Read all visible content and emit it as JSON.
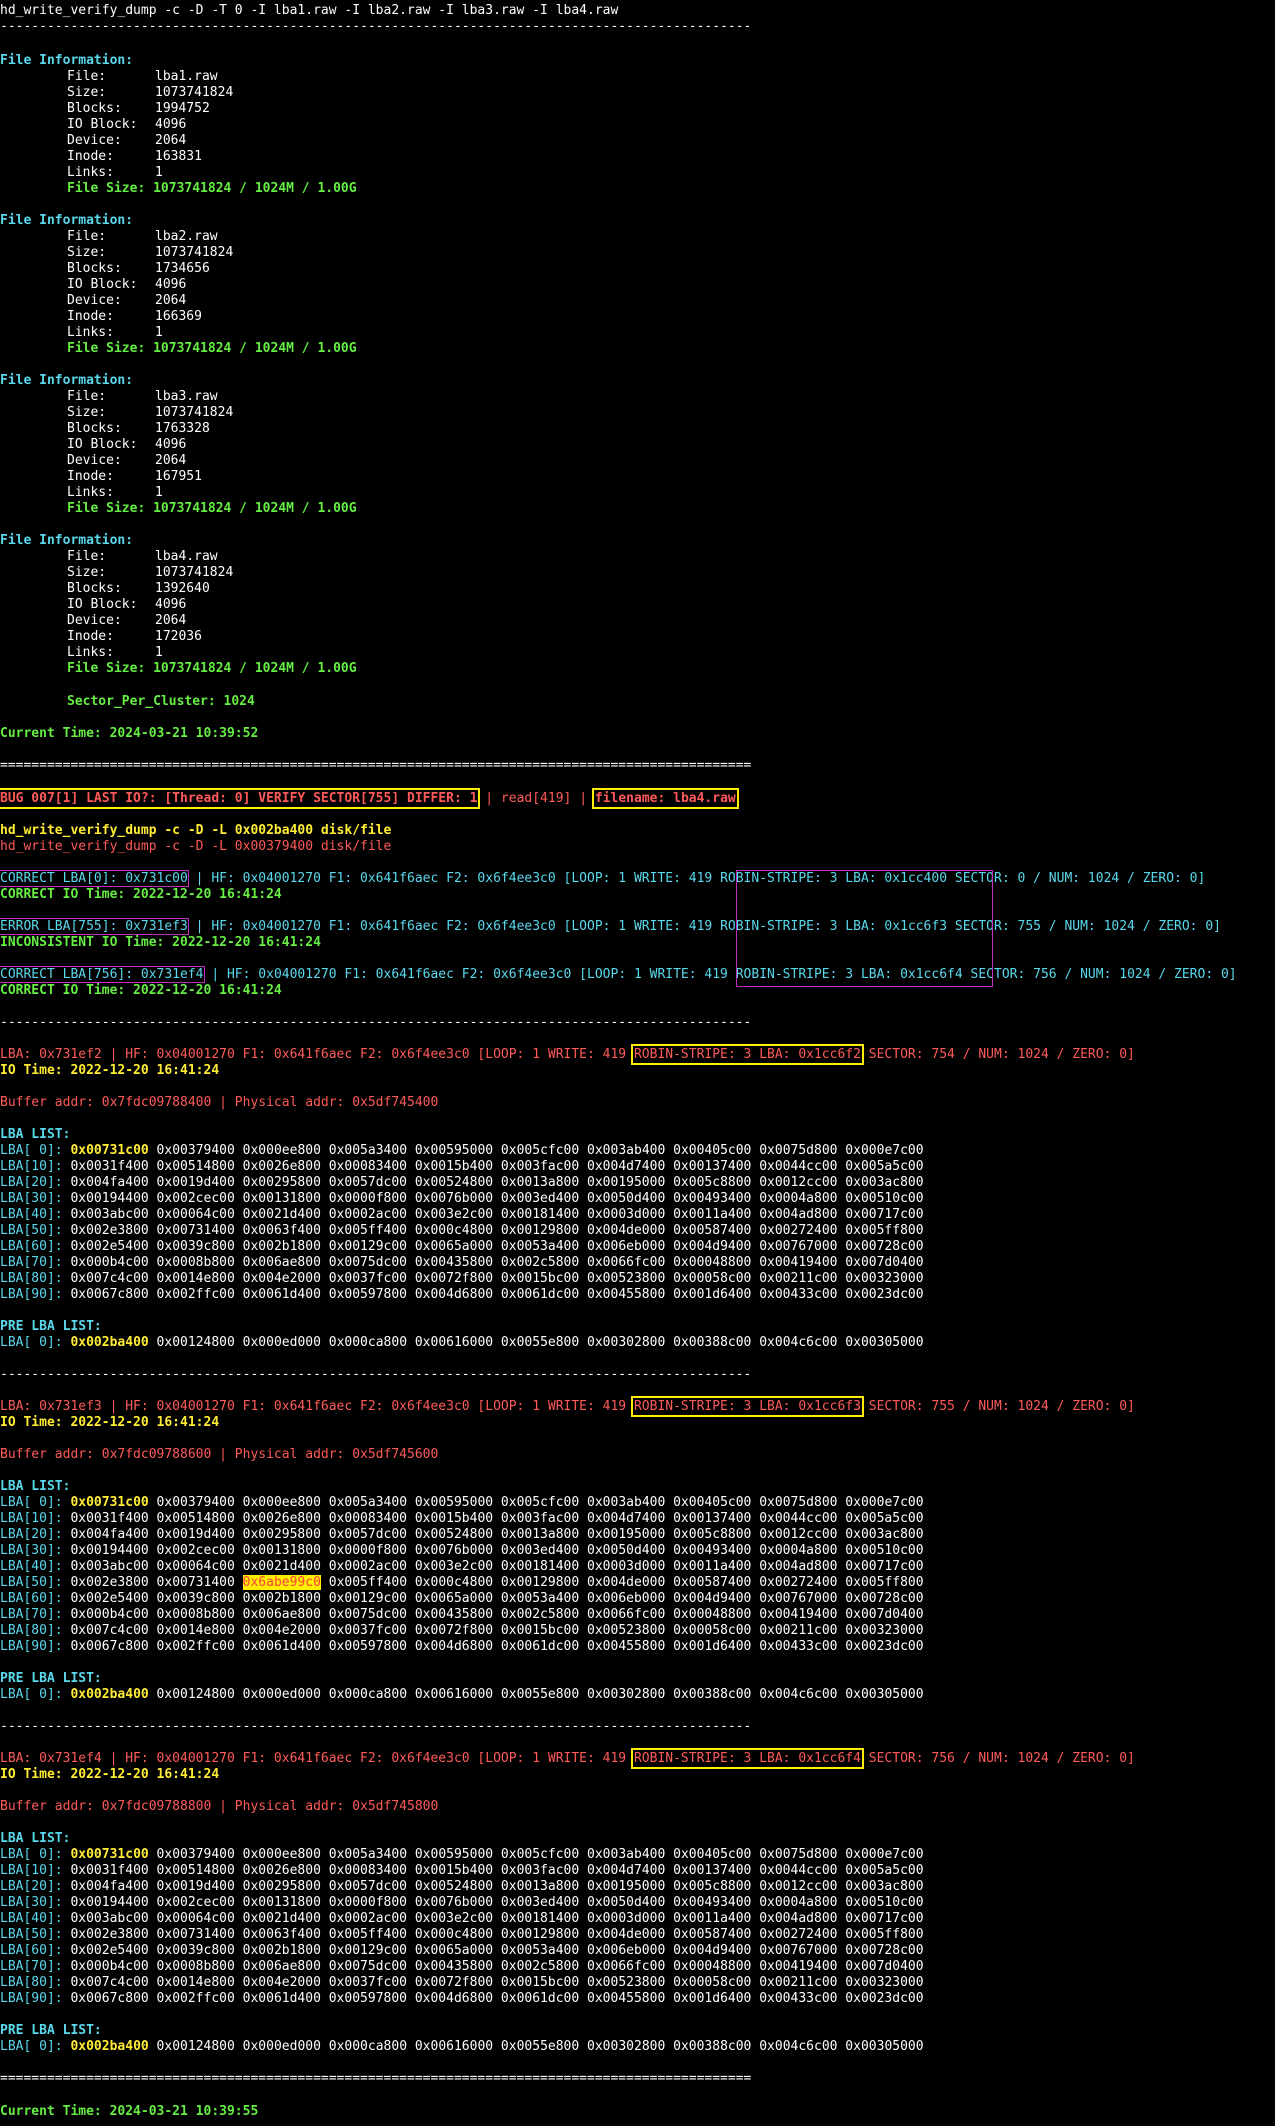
{
  "command": "hd_write_verify_dump -c -D -T 0 -I lba1.raw -I lba2.raw -I lba3.raw -I lba4.raw",
  "separator_dash": "------------------------------------------------------------------------------------------------",
  "separator_eq": "================================================================================================",
  "file_info_header": "File Information:",
  "files": [
    {
      "File:": "lba1.raw",
      "Size:": "1073741824",
      "Blocks:": "1994752",
      "IO Block:": "4096",
      "Device:": "2064",
      "Inode:": "163831",
      "Links:": "1",
      "file_size": "File Size: 1073741824 / 1024M / 1.00G"
    },
    {
      "File:": "lba2.raw",
      "Size:": "1073741824",
      "Blocks:": "1734656",
      "IO Block:": "4096",
      "Device:": "2064",
      "Inode:": "166369",
      "Links:": "1",
      "file_size": "File Size: 1073741824 / 1024M / 1.00G"
    },
    {
      "File:": "lba3.raw",
      "Size:": "1073741824",
      "Blocks:": "1763328",
      "IO Block:": "4096",
      "Device:": "2064",
      "Inode:": "167951",
      "Links:": "1",
      "file_size": "File Size: 1073741824 / 1024M / 1.00G"
    },
    {
      "File:": "lba4.raw",
      "Size:": "1073741824",
      "Blocks:": "1392640",
      "IO Block:": "4096",
      "Device:": "2064",
      "Inode:": "172036",
      "Links:": "1",
      "file_size": "File Size: 1073741824 / 1024M / 1.00G"
    }
  ],
  "field_keys": [
    "File:",
    "Size:",
    "Blocks:",
    "IO Block:",
    "Device:",
    "Inode:",
    "Links:"
  ],
  "sector_per_cluster": "Sector_Per_Cluster: 1024",
  "current_time_1": "Current Time: 2024-03-21 10:39:52",
  "current_time_2": "Current Time: 2024-03-21 10:39:55",
  "bug_line": {
    "bug": "BUG 007[1] LAST IO?: [Thread: 0] VERIFY SECTOR[755] DIFFER: 1",
    "sep1": " | ",
    "read": "read[419]",
    "sep2": " | ",
    "filename": "filename: lba4.raw"
  },
  "dump_cmd_1": "hd_write_verify_dump -c -D -L 0x002ba400 disk/file",
  "dump_cmd_2": "hd_write_verify_dump -c -D -L 0x00379400 disk/file",
  "lba_summary": [
    {
      "tag": "CORRECT LBA[0]: 0x731c00",
      "pre": " | HF: 0x04001270 F1: 0x641f6aec F2: 0x6f4ee3c0 [LOOP: 1 WRITE: 419 ",
      "stripe": "ROBIN-STRIPE: 3 LBA: 0x1cc400",
      "post": " SECTOR: 0 / NUM: 1024 / ZERO: 0]",
      "time": "CORRECT IO Time: 2022-12-20 16:41:24"
    },
    {
      "tag": "ERROR LBA[755]: 0x731ef3",
      "pre": " | HF: 0x04001270 F1: 0x641f6aec F2: 0x6f4ee3c0 [LOOP: 1 WRITE: 419 ",
      "stripe": "ROBIN-STRIPE: 3 LBA: 0x1cc6f3",
      "post": " SECTOR: 755 / NUM: 1024 / ZERO: 0]",
      "time": "INCONSISTENT IO Time: 2022-12-20 16:41:24"
    },
    {
      "tag": "CORRECT LBA[756]: 0x731ef4",
      "pre": " | HF: 0x04001270 F1: 0x641f6aec F2: 0x6f4ee3c0 [LOOP: 1 WRITE: 419 ",
      "stripe": "ROBIN-STRIPE: 3 LBA: 0x1cc6f4",
      "post": " SECTOR: 756 / NUM: 1024 / ZERO: 0]",
      "time": "CORRECT IO Time: 2022-12-20 16:41:24"
    }
  ],
  "details": [
    {
      "pre": "LBA: 0x731ef2 | HF: 0x04001270 F1: 0x641f6aec F2: 0x6f4ee3c0 [LOOP: 1 WRITE: 419 ",
      "stripe": "ROBIN-STRIPE: 3 LBA: 0x1cc6f2",
      "post": " SECTOR: 754 / NUM: 1024 / ZERO: 0]",
      "io_time": "IO Time: 2022-12-20 16:41:24",
      "buffer": "Buffer addr: 0x7fdc09788400 | Physical addr: 0x5df745400",
      "list_rows": [
        {
          "label": "LBA[ 0]: ",
          "first": "0x00731c00",
          "rest": " 0x00379400 0x000ee800 0x005a3400 0x00595000 0x005cfc00 0x003ab400 0x00405c00 0x0075d800 0x000e7c00"
        },
        {
          "label": "LBA[10]: ",
          "first": "",
          "rest": "0x0031f400 0x00514800 0x0026e800 0x00083400 0x0015b400 0x003fac00 0x004d7400 0x00137400 0x0044cc00 0x005a5c00"
        },
        {
          "label": "LBA[20]: ",
          "first": "",
          "rest": "0x004fa400 0x0019d400 0x00295800 0x0057dc00 0x00524800 0x0013a800 0x00195000 0x005c8800 0x0012cc00 0x003ac800"
        },
        {
          "label": "LBA[30]: ",
          "first": "",
          "rest": "0x00194400 0x002cec00 0x00131800 0x0000f800 0x0076b000 0x003ed400 0x0050d400 0x00493400 0x0004a800 0x00510c00"
        },
        {
          "label": "LBA[40]: ",
          "first": "",
          "rest": "0x003abc00 0x00064c00 0x0021d400 0x0002ac00 0x003e2c00 0x00181400 0x0003d000 0x0011a400 0x004ad800 0x00717c00"
        },
        {
          "label": "LBA[50]: ",
          "first": "",
          "rest": "0x002e3800 0x00731400 0x0063f400 0x005ff400 0x000c4800 0x00129800 0x004de000 0x00587400 0x00272400 0x005ff800"
        },
        {
          "label": "LBA[60]: ",
          "first": "",
          "rest": "0x002e5400 0x0039c800 0x002b1800 0x00129c00 0x0065a000 0x0053a400 0x006eb000 0x004d9400 0x00767000 0x00728c00"
        },
        {
          "label": "LBA[70]: ",
          "first": "",
          "rest": "0x000b4c00 0x0008b800 0x006ae800 0x0075dc00 0x00435800 0x002c5800 0x0066fc00 0x00048800 0x00419400 0x007d0400"
        },
        {
          "label": "LBA[80]: ",
          "first": "",
          "rest": "0x007c4c00 0x0014e800 0x004e2000 0x0037fc00 0x0072f800 0x0015bc00 0x00523800 0x00058c00 0x00211c00 0x00323000"
        },
        {
          "label": "LBA[90]: ",
          "first": "",
          "rest": "0x0067c800 0x002ffc00 0x0061d400 0x00597800 0x004d6800 0x0061dc00 0x00455800 0x001d6400 0x00433c00 0x0023dc00"
        }
      ]
    },
    {
      "pre": "LBA: 0x731ef3 | HF: 0x04001270 F1: 0x641f6aec F2: 0x6f4ee3c0 [LOOP: 1 WRITE: 419 ",
      "stripe": "ROBIN-STRIPE: 3 LBA: 0x1cc6f3",
      "post": " SECTOR: 755 / NUM: 1024 / ZERO: 0]",
      "io_time": "IO Time: 2022-12-20 16:41:24",
      "buffer": "Buffer addr: 0x7fdc09788600 | Physical addr: 0x5df745600",
      "highlight_value": "0x6abe99c0",
      "list_rows": [
        {
          "label": "LBA[ 0]: ",
          "first": "0x00731c00",
          "rest": " 0x00379400 0x000ee800 0x005a3400 0x00595000 0x005cfc00 0x003ab400 0x00405c00 0x0075d800 0x000e7c00"
        },
        {
          "label": "LBA[10]: ",
          "first": "",
          "rest": "0x0031f400 0x00514800 0x0026e800 0x00083400 0x0015b400 0x003fac00 0x004d7400 0x00137400 0x0044cc00 0x005a5c00"
        },
        {
          "label": "LBA[20]: ",
          "first": "",
          "rest": "0x004fa400 0x0019d400 0x00295800 0x0057dc00 0x00524800 0x0013a800 0x00195000 0x005c8800 0x0012cc00 0x003ac800"
        },
        {
          "label": "LBA[30]: ",
          "first": "",
          "rest": "0x00194400 0x002cec00 0x00131800 0x0000f800 0x0076b000 0x003ed400 0x0050d400 0x00493400 0x0004a800 0x00510c00"
        },
        {
          "label": "LBA[40]: ",
          "first": "",
          "rest": "0x003abc00 0x00064c00 0x0021d400 0x0002ac00 0x003e2c00 0x00181400 0x0003d000 0x0011a400 0x004ad800 0x00717c00"
        },
        {
          "label": "LBA[50]: ",
          "first": "",
          "rest": "0x002e3800 0x00731400 ",
          "hl": "0x6abe99c0",
          "tail": " 0x005ff400 0x000c4800 0x00129800 0x004de000 0x00587400 0x00272400 0x005ff800"
        },
        {
          "label": "LBA[60]: ",
          "first": "",
          "rest": "0x002e5400 0x0039c800 0x002b1800 0x00129c00 0x0065a000 0x0053a400 0x006eb000 0x004d9400 0x00767000 0x00728c00"
        },
        {
          "label": "LBA[70]: ",
          "first": "",
          "rest": "0x000b4c00 0x0008b800 0x006ae800 0x0075dc00 0x00435800 0x002c5800 0x0066fc00 0x00048800 0x00419400 0x007d0400"
        },
        {
          "label": "LBA[80]: ",
          "first": "",
          "rest": "0x007c4c00 0x0014e800 0x004e2000 0x0037fc00 0x0072f800 0x0015bc00 0x00523800 0x00058c00 0x00211c00 0x00323000"
        },
        {
          "label": "LBA[90]: ",
          "first": "",
          "rest": "0x0067c800 0x002ffc00 0x0061d400 0x00597800 0x004d6800 0x0061dc00 0x00455800 0x001d6400 0x00433c00 0x0023dc00"
        }
      ]
    },
    {
      "pre": "LBA: 0x731ef4 | HF: 0x04001270 F1: 0x641f6aec F2: 0x6f4ee3c0 [LOOP: 1 WRITE: 419 ",
      "stripe": "ROBIN-STRIPE: 3 LBA: 0x1cc6f4",
      "post": " SECTOR: 756 / NUM: 1024 / ZERO: 0]",
      "io_time": "IO Time: 2022-12-20 16:41:24",
      "buffer": "Buffer addr: 0x7fdc09788800 | Physical addr: 0x5df745800",
      "list_rows": [
        {
          "label": "LBA[ 0]: ",
          "first": "0x00731c00",
          "rest": " 0x00379400 0x000ee800 0x005a3400 0x00595000 0x005cfc00 0x003ab400 0x00405c00 0x0075d800 0x000e7c00"
        },
        {
          "label": "LBA[10]: ",
          "first": "",
          "rest": "0x0031f400 0x00514800 0x0026e800 0x00083400 0x0015b400 0x003fac00 0x004d7400 0x00137400 0x0044cc00 0x005a5c00"
        },
        {
          "label": "LBA[20]: ",
          "first": "",
          "rest": "0x004fa400 0x0019d400 0x00295800 0x0057dc00 0x00524800 0x0013a800 0x00195000 0x005c8800 0x0012cc00 0x003ac800"
        },
        {
          "label": "LBA[30]: ",
          "first": "",
          "rest": "0x00194400 0x002cec00 0x00131800 0x0000f800 0x0076b000 0x003ed400 0x0050d400 0x00493400 0x0004a800 0x00510c00"
        },
        {
          "label": "LBA[40]: ",
          "first": "",
          "rest": "0x003abc00 0x00064c00 0x0021d400 0x0002ac00 0x003e2c00 0x00181400 0x0003d000 0x0011a400 0x004ad800 0x00717c00"
        },
        {
          "label": "LBA[50]: ",
          "first": "",
          "rest": "0x002e3800 0x00731400 0x0063f400 0x005ff400 0x000c4800 0x00129800 0x004de000 0x00587400 0x00272400 0x005ff800"
        },
        {
          "label": "LBA[60]: ",
          "first": "",
          "rest": "0x002e5400 0x0039c800 0x002b1800 0x00129c00 0x0065a000 0x0053a400 0x006eb000 0x004d9400 0x00767000 0x00728c00"
        },
        {
          "label": "LBA[70]: ",
          "first": "",
          "rest": "0x000b4c00 0x0008b800 0x006ae800 0x0075dc00 0x00435800 0x002c5800 0x0066fc00 0x00048800 0x00419400 0x007d0400"
        },
        {
          "label": "LBA[80]: ",
          "first": "",
          "rest": "0x007c4c00 0x0014e800 0x004e2000 0x0037fc00 0x0072f800 0x0015bc00 0x00523800 0x00058c00 0x00211c00 0x00323000"
        },
        {
          "label": "LBA[90]: ",
          "first": "",
          "rest": "0x0067c800 0x002ffc00 0x0061d400 0x00597800 0x004d6800 0x0061dc00 0x00455800 0x001d6400 0x00433c00 0x0023dc00"
        }
      ]
    }
  ],
  "lba_list_header": "LBA LIST:",
  "pre_lba_header": "PRE LBA LIST:",
  "pre_lba_row": {
    "label": "LBA[ 0]: ",
    "first": "0x002ba400",
    "rest": " 0x00124800 0x000ed000 0x000ca800 0x00616000 0x0055e800 0x00302800 0x00388c00 0x004c6c00 0x00305000"
  },
  "colors": {
    "background": "#000000",
    "cyan": "#5ad8ec",
    "green": "#66ee44",
    "yellow": "#ffee33",
    "red": "#ff5a5a",
    "box_yellow": "#ffee00",
    "box_purple": "#c030c0"
  }
}
